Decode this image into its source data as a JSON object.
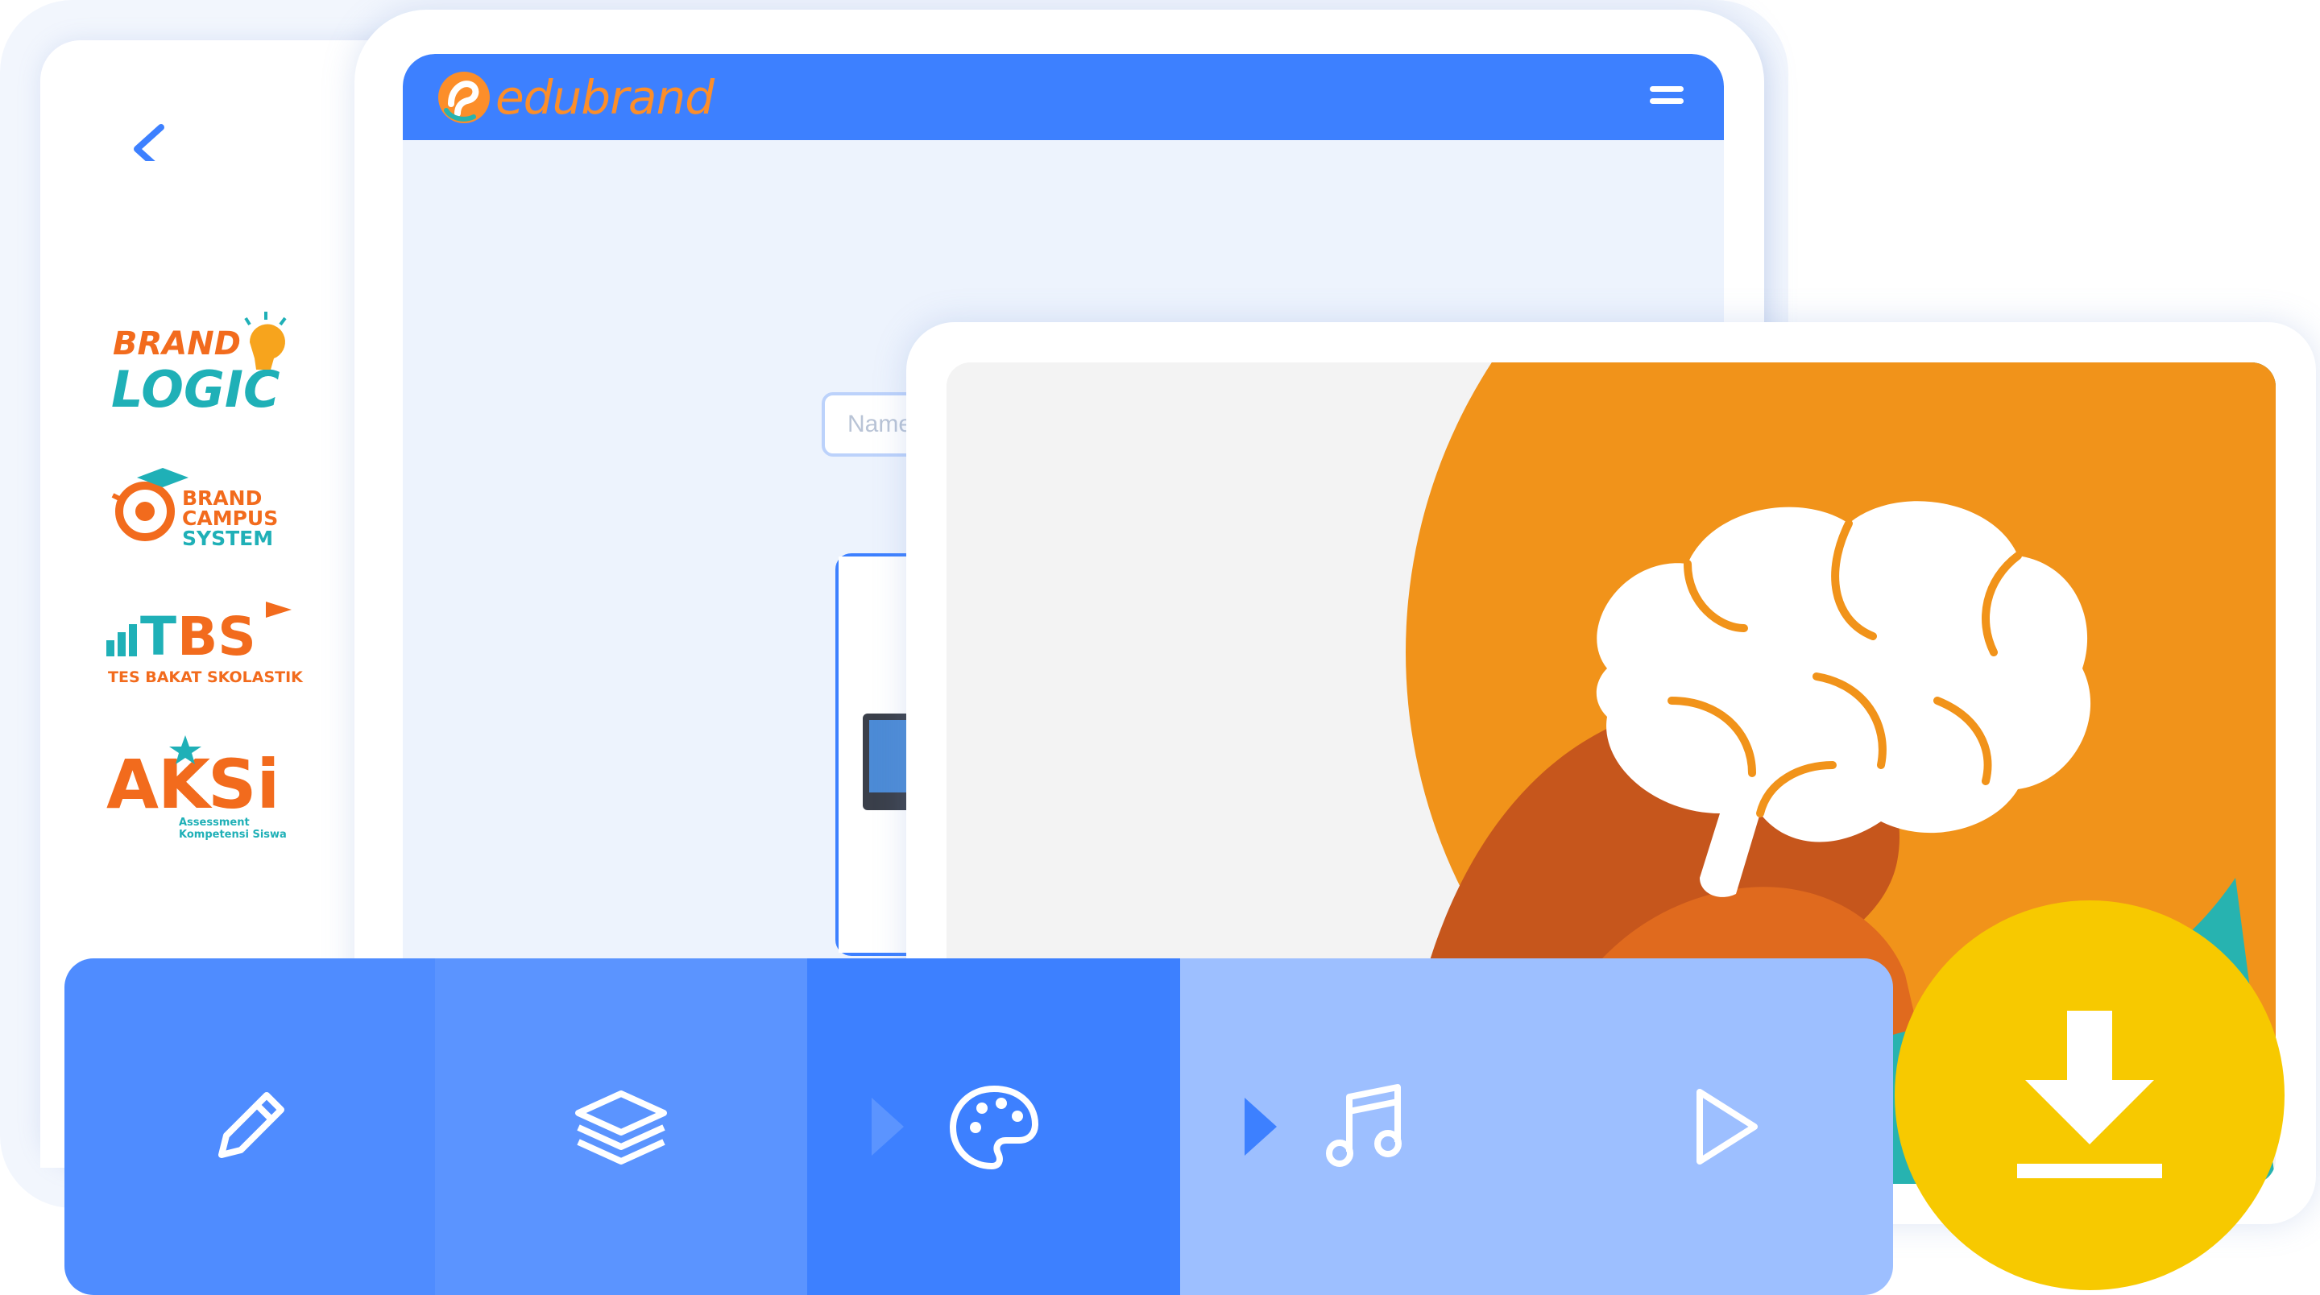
{
  "app": {
    "brand_name": "edubrand"
  },
  "colors": {
    "primary": "#3d80ff",
    "brand_orange": "#fc8e2a",
    "accent_teal": "#27b3b0",
    "download_yellow": "#f7c900"
  },
  "sidebar": {
    "brands": [
      {
        "name": "BRAND LOGIC",
        "icon": "lightbulb-icon"
      },
      {
        "name": "BRAND CAMPUS SYSTEM",
        "icon": "graduation-cap-icon"
      },
      {
        "name": "TBS TES BAKAT SKOLASTIK",
        "icon": "bar-chart-icon"
      },
      {
        "name": "AKSI Assessment Kompetensi Siswa",
        "icon": "star-icon"
      }
    ]
  },
  "editor": {
    "name_placeholder": "Name"
  },
  "toolbar": {
    "tools": [
      {
        "id": "edit",
        "icon": "pencil-icon"
      },
      {
        "id": "layers",
        "icon": "layers-icon"
      },
      {
        "id": "color",
        "icon": "palette-icon"
      },
      {
        "id": "music",
        "icon": "music-note-icon"
      },
      {
        "id": "play",
        "icon": "play-icon"
      }
    ],
    "active": "color",
    "download_icon": "download-icon"
  }
}
